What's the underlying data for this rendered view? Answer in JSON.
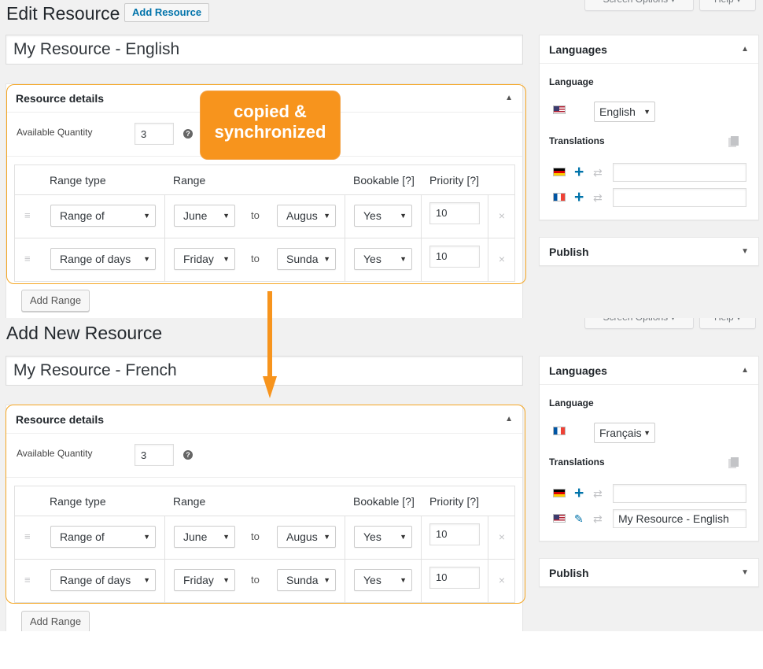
{
  "edit_screen": {
    "screen_options_label": "Screen Options ▾",
    "help_label": "Help ▾",
    "page_title": "Edit Resource",
    "add_button_label": "Add Resource",
    "title_value": "My Resource - English",
    "details": {
      "title": "Resource details",
      "quantity_label": "Available Quantity",
      "quantity_value": "3",
      "columns": [
        "Range type",
        "Range",
        "Bookable",
        "Priority"
      ],
      "help_link": "[?]",
      "to_label": "to",
      "rows": [
        {
          "range_type": "Range of",
          "from": "June",
          "to": "Augus",
          "bookable": "Yes",
          "priority": "10"
        },
        {
          "range_type": "Range of days",
          "from": "Friday",
          "to": "Sunda",
          "bookable": "Yes",
          "priority": "10"
        }
      ],
      "add_range_label": "Add Range"
    },
    "languages": {
      "title": "Languages",
      "language_label": "Language",
      "language_value": "English",
      "translations_label": "Translations",
      "translations": [
        {
          "flag": "flag-de-icon",
          "action": "plus-icon",
          "value": ""
        },
        {
          "flag": "flag-fr-icon",
          "action": "plus-icon",
          "value": ""
        }
      ]
    },
    "publish_title": "Publish"
  },
  "new_screen": {
    "screen_options_label": "Screen Options ▾",
    "help_label": "Help ▾",
    "page_title": "Add New Resource",
    "title_value": "My Resource - French",
    "details": {
      "title": "Resource details",
      "quantity_label": "Available Quantity",
      "quantity_value": "3",
      "columns": [
        "Range type",
        "Range",
        "Bookable",
        "Priority"
      ],
      "help_link": "[?]",
      "to_label": "to",
      "rows": [
        {
          "range_type": "Range of",
          "from": "June",
          "to": "Augus",
          "bookable": "Yes",
          "priority": "10"
        },
        {
          "range_type": "Range of days",
          "from": "Friday",
          "to": "Sunda",
          "bookable": "Yes",
          "priority": "10"
        }
      ],
      "add_range_label": "Add Range"
    },
    "languages": {
      "title": "Languages",
      "language_label": "Language",
      "language_value": "Français",
      "translations_label": "Translations",
      "translations": [
        {
          "flag": "flag-de-icon",
          "action": "plus-icon",
          "value": ""
        },
        {
          "flag": "flag-us-icon",
          "action": "pencil-icon",
          "value": "My Resource - English"
        }
      ]
    },
    "publish_title": "Publish"
  },
  "callout": {
    "line1": "copied &",
    "line2": "synchronized"
  },
  "colors": {
    "accent_orange": "#f7941d",
    "outline_orange": "#f5a623",
    "link_blue": "#0073aa",
    "admin_background": "#f1f1f1"
  }
}
